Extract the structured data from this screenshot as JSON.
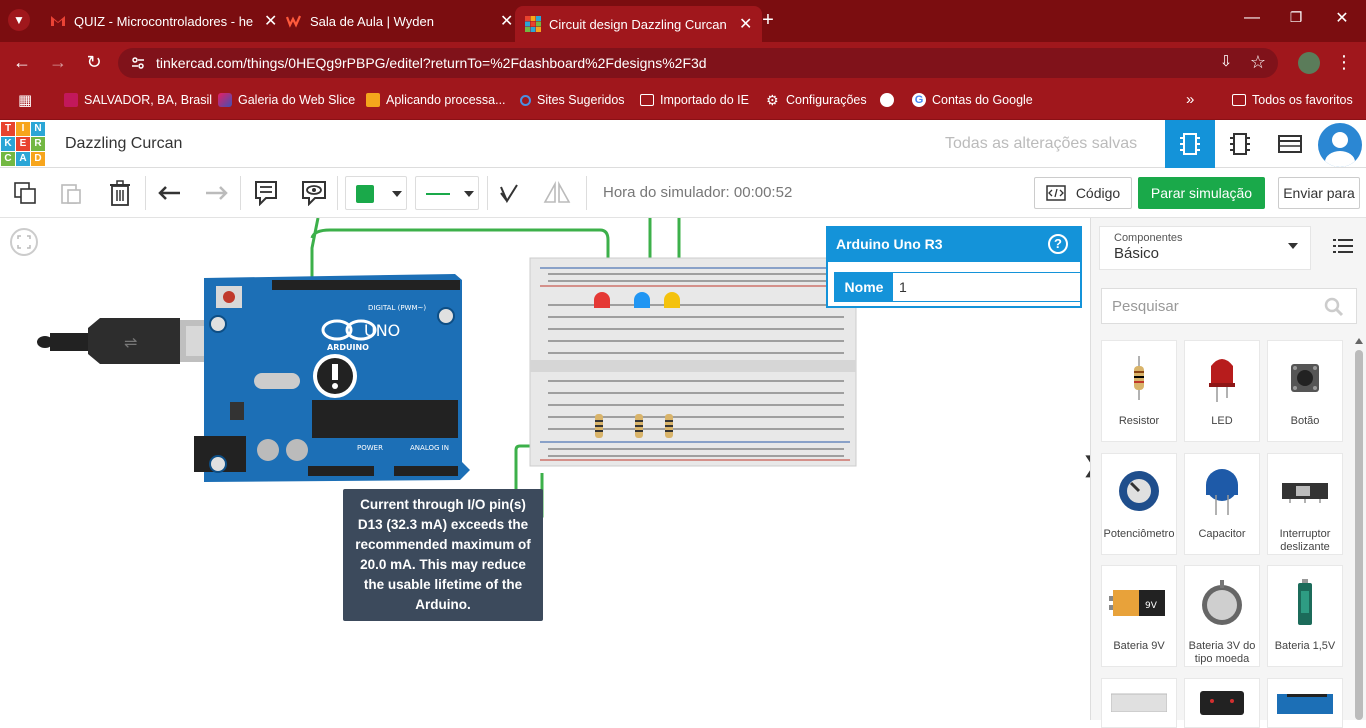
{
  "browser": {
    "tabs": [
      {
        "title": "QUIZ - Microcontroladores - he",
        "close": "✕"
      },
      {
        "title": "Sala de Aula | Wyden",
        "close": "✕"
      },
      {
        "title": "Circuit design Dazzling Curcan",
        "close": "✕"
      }
    ],
    "new_tab": "+",
    "url": "tinkercad.com/things/0HEQg9rPBPG/editel?returnTo=%2Fdashboard%2Fdesigns%2F3d",
    "bookmarks": [
      "SALVADOR, BA, Brasil",
      "Galeria do Web Slice",
      "Aplicando processa...",
      "Sites Sugeridos",
      "Importado do IE",
      "Configurações",
      "Contas do Google"
    ],
    "more_bookmarks": "»",
    "all_favorites": "Todos os favoritos"
  },
  "app": {
    "logo_letters": [
      "T",
      "I",
      "N",
      "K",
      "E",
      "R",
      "C",
      "A",
      "D"
    ],
    "design_name": "Dazzling Curcan",
    "saved_status": "Todas as alterações salvas"
  },
  "toolbar": {
    "simulator_time": "Hora do simulador: 00:00:52",
    "code_button": "Código",
    "stop_button": "Parar simulação",
    "send_button": "Enviar para"
  },
  "canvas": {
    "warning_tooltip": "Current through I/O pin(s) D13 (32.3 mA) exceeds the recommended maximum of 20.0 mA. This may reduce the usable lifetime of the Arduino.",
    "arduino_label": "UNO",
    "arduino_brand": "ARDUINO",
    "digital_label": "DIGITAL (PWM~)",
    "power_label": "POWER",
    "analog_label": "ANALOG IN"
  },
  "properties": {
    "title": "Arduino Uno R3",
    "help": "?",
    "name_label": "Nome",
    "name_value": "1"
  },
  "panel": {
    "components_label": "Componentes",
    "components_value": "Básico",
    "search_placeholder": "Pesquisar",
    "components": [
      "Resistor",
      "LED",
      "Botão",
      "Potenciômetro",
      "Capacitor",
      "Interruptor deslizante",
      "Bateria 9V",
      "Bateria 3V do tipo moeda",
      "Bateria 1,5V"
    ]
  },
  "colors": {
    "browser_dark": "#7b0d10",
    "browser_bar": "#a0171c",
    "tinkercad_blue": "#1493d9",
    "stop_green": "#1aa94a",
    "wire_green": "#3cb04a",
    "arduino_blue": "#1c6fb6"
  }
}
